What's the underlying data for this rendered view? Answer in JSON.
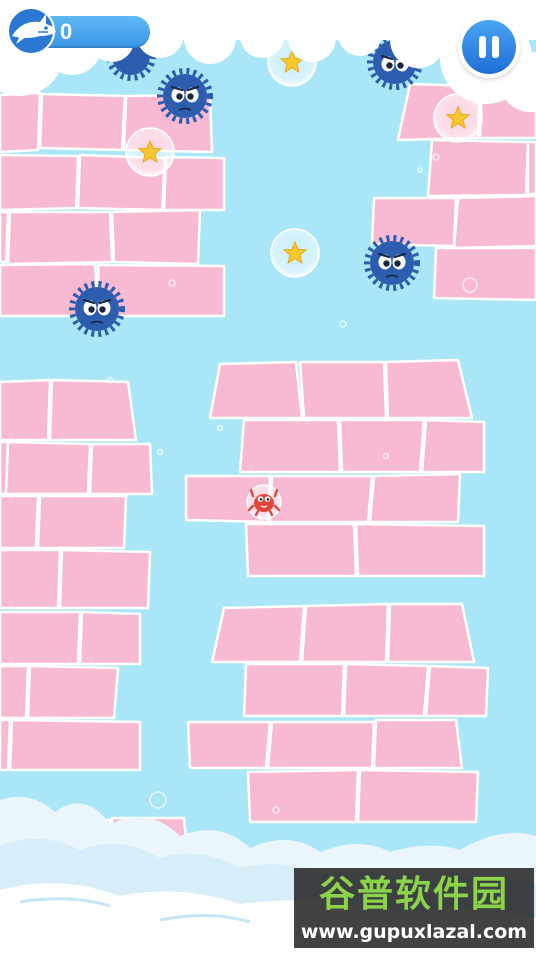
{
  "hud": {
    "score": "0",
    "score_icon": "shark-icon",
    "pause_icon": "pause-icon"
  },
  "colors": {
    "background": "#a9e6f7",
    "brick": "#f8bad3",
    "urchin": "#2d5dae",
    "player": "#e2463a",
    "star": "#f7c82e",
    "hud_blue": "#3a95e6"
  },
  "watermark": {
    "title": "谷普软件园",
    "url": "www.gupuxlazal.com"
  }
}
